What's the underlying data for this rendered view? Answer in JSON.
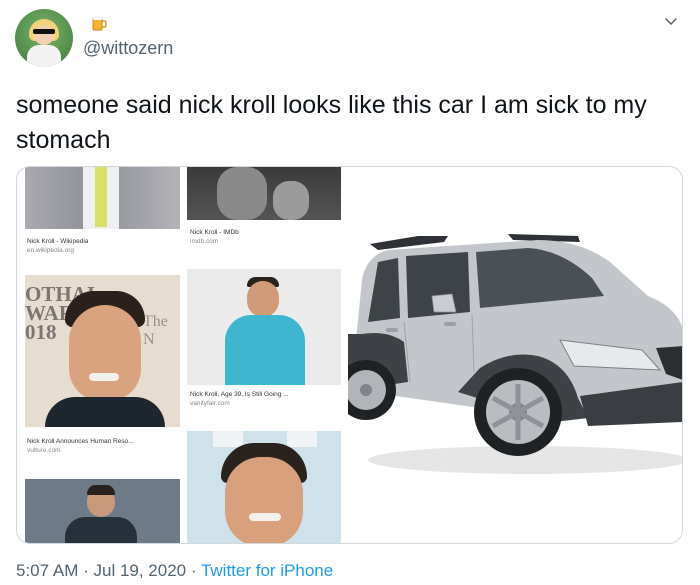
{
  "user": {
    "handle": "@wittozern",
    "avatar_icon": "cartoon-avatar",
    "name_emoji_icon": "beer-mug-icon"
  },
  "tweet": {
    "text": "someone said nick kroll looks like this car I am sick to my stomach"
  },
  "media": {
    "thumbnails": [
      {
        "title": "Nick Kroll - Wikipedia",
        "source": "en.wikipedia.org"
      },
      {
        "title": "Nick Kroll - IMDb",
        "source": "imdb.com"
      },
      {
        "title": "Nick Kroll, Age 39, Is Still Going ...",
        "source": "vanityfair.com"
      },
      {
        "title": "Nick Kroll Announces Human Reso...",
        "source": "vulture.com"
      }
    ],
    "backdrop_text": [
      "OTHAI",
      "WARD",
      "018",
      "The N"
    ]
  },
  "footer": {
    "time": "5:07 AM",
    "sep1": " · ",
    "date": "Jul 19, 2020",
    "sep2": " · ",
    "client": "Twitter for iPhone"
  },
  "colors": {
    "link": "#1d9bf0",
    "secondary_text": "#536471",
    "border": "#cfd9de"
  }
}
